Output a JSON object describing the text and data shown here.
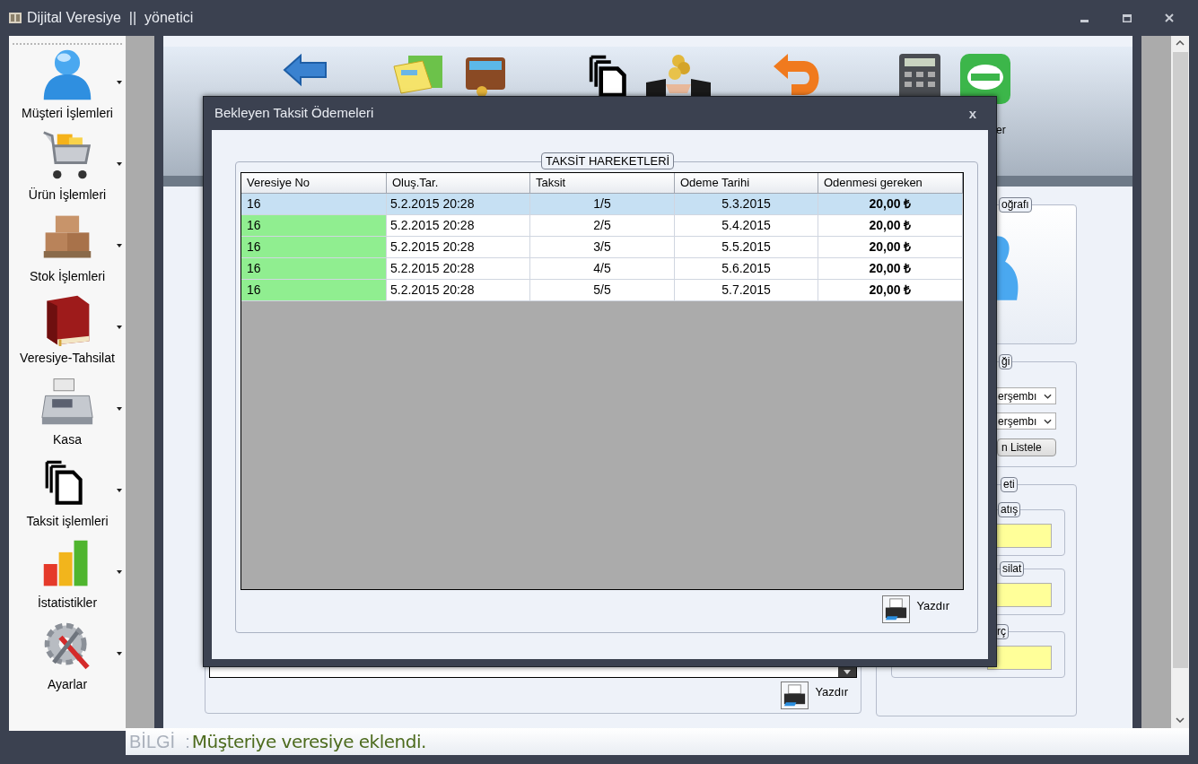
{
  "window": {
    "title": "Dijital Veresiye  ||  yönetici"
  },
  "sidebar": {
    "items": [
      {
        "label": "Müşteri İşlemleri"
      },
      {
        "label": "Ürün İşlemleri"
      },
      {
        "label": "Stok İşlemleri"
      },
      {
        "label": "Veresiye-Tahsilat"
      },
      {
        "label": "Kasa"
      },
      {
        "label": "Taksit işlemleri"
      },
      {
        "label": "İstatistikler"
      },
      {
        "label": "Ayarlar"
      }
    ]
  },
  "form": {
    "toolbar_label": "er",
    "print_label": "Yazdır",
    "photo_legend": "oğrafı",
    "date_legend": "ği",
    "date_from": "erşembı",
    "date_to": "erşembı",
    "list_button": "n Listele",
    "summary_legend": "eti",
    "summary_groups": [
      {
        "legend": "atış"
      },
      {
        "legend": "silat"
      },
      {
        "legend": "rç"
      }
    ]
  },
  "dialog": {
    "title": "Bekleyen Taksit Ödemeleri",
    "close": "x",
    "legend": "TAKSİT HAREKETLERİ",
    "table": {
      "columns": [
        "Veresiye No",
        "Oluş.Tar.",
        "Taksit",
        "Odeme Tarihi",
        "Odenmesi gereken"
      ],
      "rows": [
        {
          "cells": [
            "16",
            "5.2.2015 20:28",
            "1/5",
            "5.3.2015",
            "20,00 ₺"
          ],
          "selected": true,
          "highlighted": false
        },
        {
          "cells": [
            "16",
            "5.2.2015 20:28",
            "2/5",
            "5.4.2015",
            "20,00 ₺"
          ],
          "selected": false,
          "highlighted": true
        },
        {
          "cells": [
            "16",
            "5.2.2015 20:28",
            "3/5",
            "5.5.2015",
            "20,00 ₺"
          ],
          "selected": false,
          "highlighted": true
        },
        {
          "cells": [
            "16",
            "5.2.2015 20:28",
            "4/5",
            "5.6.2015",
            "20,00 ₺"
          ],
          "selected": false,
          "highlighted": true
        },
        {
          "cells": [
            "16",
            "5.2.2015 20:28",
            "5/5",
            "5.7.2015",
            "20,00 ₺"
          ],
          "selected": false,
          "highlighted": true
        }
      ]
    },
    "print_label": "Yazdır"
  },
  "status_bar": {
    "label": "BİLGİ  :",
    "message": "Müşteriye veresiye eklendi."
  }
}
